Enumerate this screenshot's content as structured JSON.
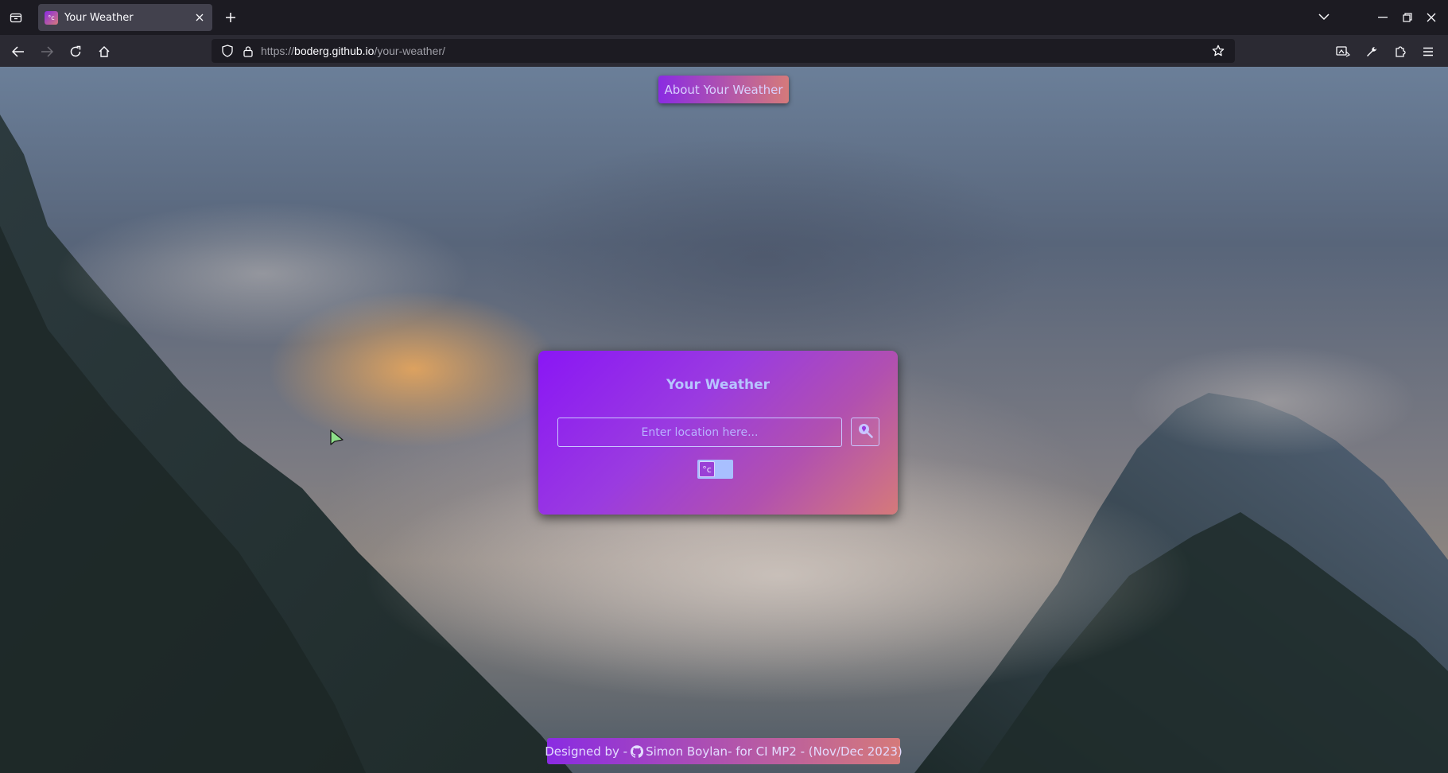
{
  "browser": {
    "tab": {
      "title": "Your Weather",
      "favicon_text": "°c"
    },
    "url": {
      "scheme": "https://",
      "host": "boderg.github.io",
      "path": "/your-weather/"
    },
    "icons": {
      "tab_overview": "tab-overview-icon",
      "new_tab": "plus-icon",
      "list_tabs": "chevron-down-icon",
      "minimize": "minimize-icon",
      "restore": "restore-icon",
      "close": "close-icon",
      "back": "arrow-left-icon",
      "forward": "arrow-right-icon",
      "reload": "reload-icon",
      "home": "home-icon",
      "shield": "shield-icon",
      "lock": "lock-icon",
      "bookmark": "star-icon",
      "screenshot": "screenshot-icon",
      "devtools": "wrench-icon",
      "extensions": "puzzle-icon",
      "menu": "hamburger-icon"
    },
    "colors": {
      "tabbar": "#1c1b22",
      "navbar": "#2b2a33",
      "tab_active": "#42414d"
    }
  },
  "page": {
    "about_button": "About Your Weather",
    "card": {
      "title": "Your Weather",
      "search_placeholder": "Enter location here...",
      "search_icon": "search-location-icon",
      "unit_toggle": {
        "label": "°c",
        "selected": "celsius"
      }
    },
    "footer": {
      "prefix": "Designed by - ",
      "icon": "github-icon",
      "author": "Simon Boylan",
      "suffix": " - for CI MP2 - (Nov/Dec 2023)"
    },
    "colors": {
      "gradient_start": "#8a2be2",
      "gradient_end": "#d57a7a",
      "title_text": "#b7c4ff"
    }
  }
}
